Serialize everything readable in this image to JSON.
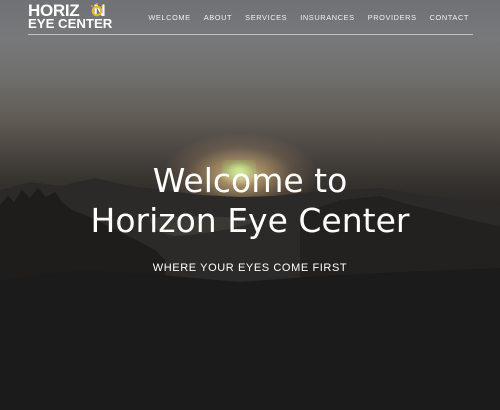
{
  "logo": {
    "line1_left": "HORIZ",
    "line1_right": "N",
    "line2": "EYE CENTER",
    "sun_icon": "sun-icon",
    "accent": "#f2b233"
  },
  "nav": {
    "items": [
      {
        "label": "WELCOME"
      },
      {
        "label": "ABOUT"
      },
      {
        "label": "SERVICES"
      },
      {
        "label": "INSURANCES"
      },
      {
        "label": "PROVIDERS"
      },
      {
        "label": "CONTACT"
      }
    ]
  },
  "hero": {
    "headline_line1": "Welcome to",
    "headline_line2": "Horizon Eye Center",
    "tagline": "WHERE YOUR EYES COME FIRST"
  }
}
